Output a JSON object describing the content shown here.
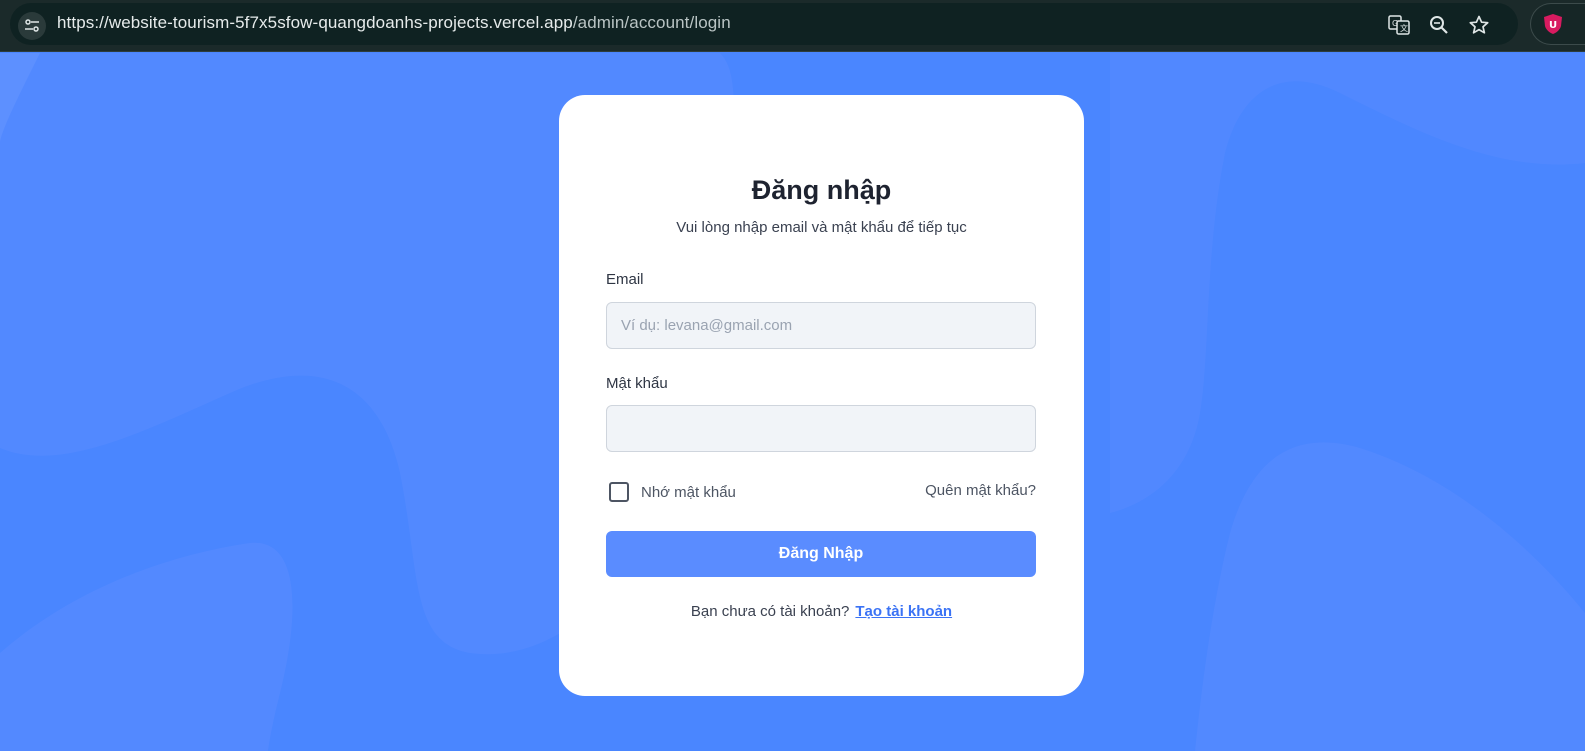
{
  "browser": {
    "url_host": "https://website-tourism-5f7x5sfow-quangdoanhs-projects.vercel.app",
    "url_path": "/admin/account/login",
    "icons": [
      "tune-icon",
      "translate-icon",
      "zoom-icon",
      "star-icon",
      "ublock-icon"
    ]
  },
  "colors": {
    "background": "#4a86ff",
    "primary_button": "#5a8cff",
    "link": "#3b73f5"
  },
  "login": {
    "title": "Đăng nhập",
    "subtitle": "Vui lòng nhập email và mật khẩu để tiếp tục",
    "email_label": "Email",
    "email_placeholder": "Ví dụ: levana@gmail.com",
    "email_value": "",
    "password_label": "Mật khẩu",
    "password_value": "",
    "remember_label": "Nhớ mật khẩu",
    "remember_checked": false,
    "forgot_label": "Quên mật khẩu?",
    "submit_label": "Đăng Nhập",
    "signup_prompt": "Bạn chưa có tài khoản?",
    "signup_link": "Tạo tài khoản"
  }
}
